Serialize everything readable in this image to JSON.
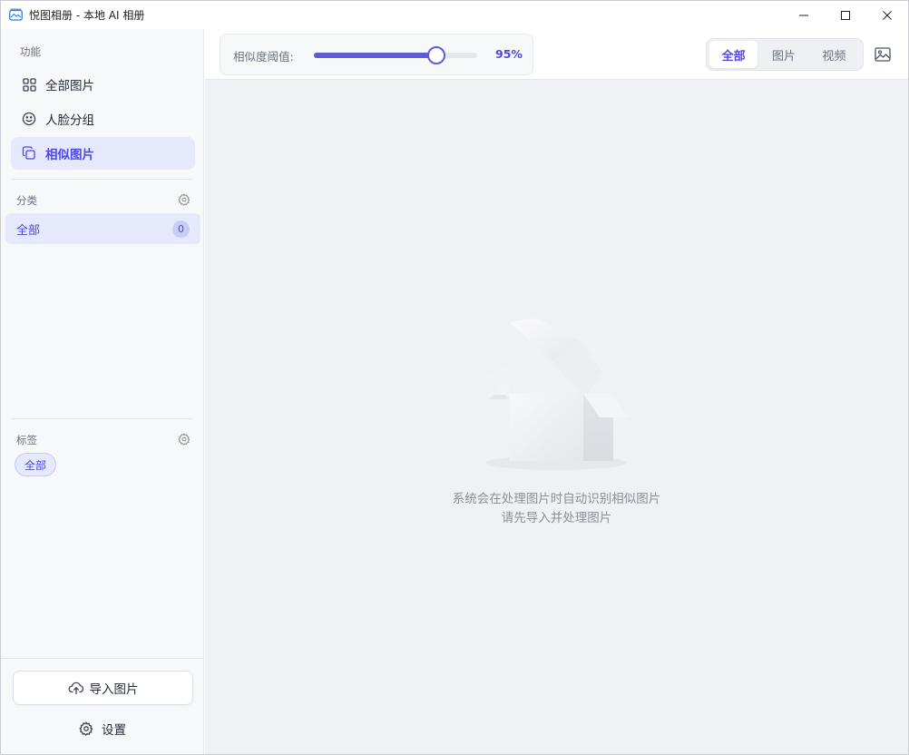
{
  "window": {
    "title": "悦图相册 - 本地 AI 相册"
  },
  "sidebar": {
    "features_label": "功能",
    "nav": [
      {
        "label": "全部图片",
        "icon": "grid-icon"
      },
      {
        "label": "人脸分组",
        "icon": "smile-icon"
      },
      {
        "label": "相似图片",
        "icon": "copy-icon",
        "active": true
      }
    ],
    "categories_label": "分类",
    "categories": [
      {
        "label": "全部",
        "count": "0"
      }
    ],
    "tags_label": "标签",
    "tags": [
      {
        "label": "全部"
      }
    ],
    "import_button": "导入图片",
    "settings": "设置"
  },
  "toolbar": {
    "threshold_label": "相似度阈值:",
    "threshold_value": "95%",
    "threshold_fraction": 0.75,
    "filters": [
      {
        "label": "全部",
        "active": true
      },
      {
        "label": "图片"
      },
      {
        "label": "视频"
      }
    ]
  },
  "empty_state": {
    "line1": "系统会在处理图片时自动识别相似图片",
    "line2": "请先导入并处理图片"
  },
  "colors": {
    "accent": "#4f46e5",
    "slider": "#5b5cd6",
    "active_bg": "#e6e8fb"
  }
}
